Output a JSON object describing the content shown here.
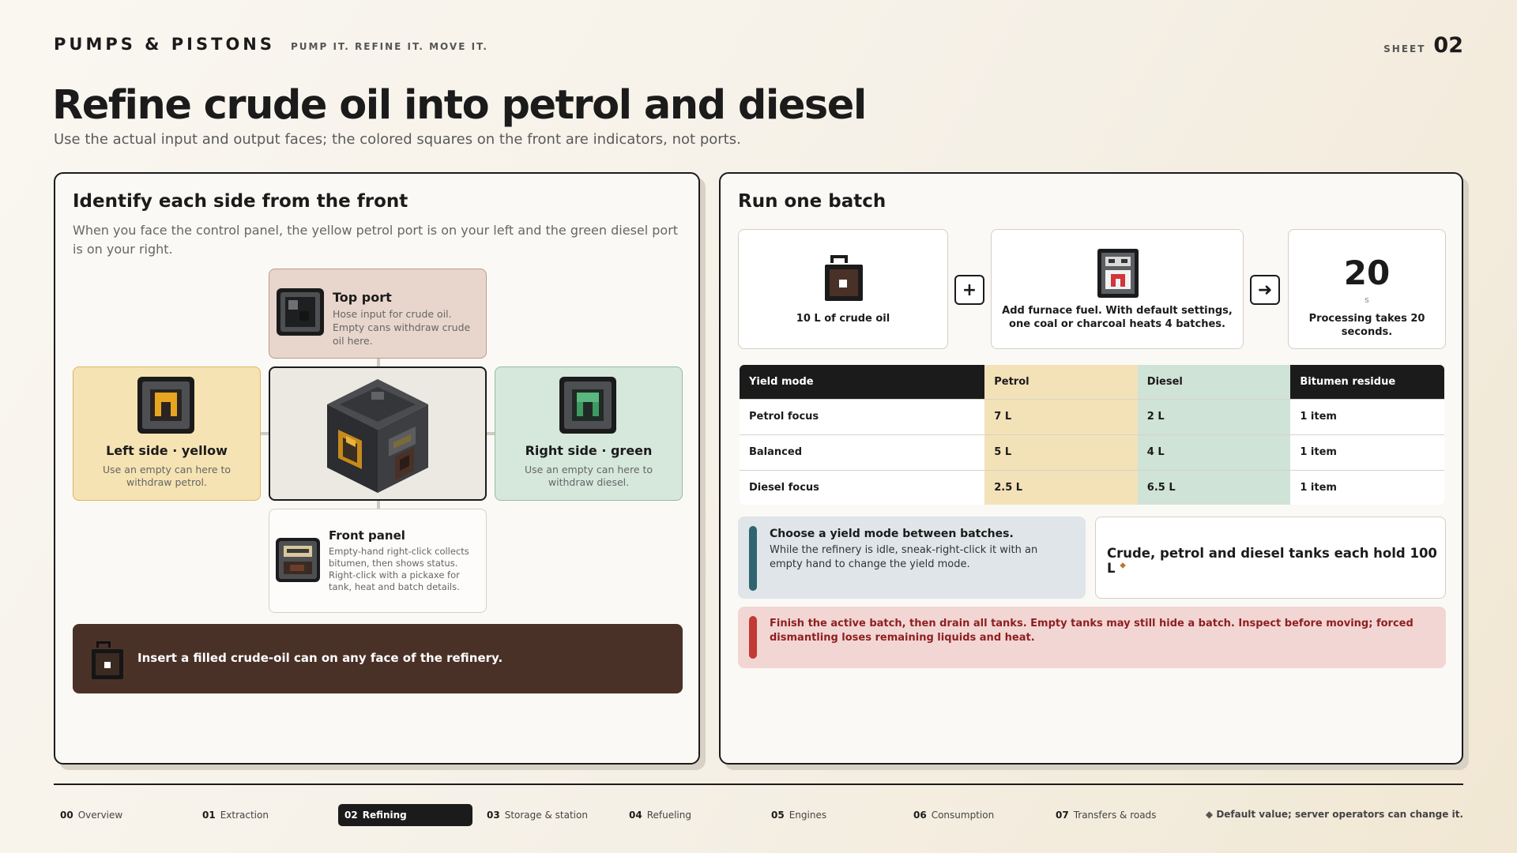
{
  "header": {
    "brand": "PUMPS & PISTONS",
    "tagline": "PUMP IT. REFINE IT. MOVE IT.",
    "sheet_label": "SHEET",
    "sheet_number": "02",
    "title": "Refine crude oil into petrol and diesel",
    "subtitle": "Use the actual input and output faces; the colored squares on the front are indicators, not ports."
  },
  "left_panel": {
    "title": "Identify each side from the front",
    "description": "When you face the control panel, the yellow petrol port is on your left and the green diesel port is on your right.",
    "top_port": {
      "title": "Top port",
      "text": "Hose input for crude oil. Empty cans withdraw crude oil here."
    },
    "left_side": {
      "title": "Left side · yellow",
      "text": "Use an empty can here to withdraw petrol."
    },
    "right_side": {
      "title": "Right side · green",
      "text": "Use an empty can here to withdraw diesel."
    },
    "front_panel": {
      "title": "Front panel",
      "text": "Empty-hand right-click collects bitumen, then shows status. Right-click with a pickaxe for tank, heat and batch details."
    },
    "insert_note": "Insert a filled crude-oil can on any face of the refinery."
  },
  "right_panel": {
    "title": "Run one batch",
    "step_input": "10 L of crude oil",
    "step_fuel": "Add furnace fuel. With default settings, one coal or charcoal heats 4 batches.",
    "plus": "+",
    "arrow": "➜",
    "processing_value": "20",
    "processing_unit": "s",
    "processing_text": "Processing takes 20 seconds.",
    "table": {
      "headers": [
        "Yield mode",
        "Petrol",
        "Diesel",
        "Bitumen residue"
      ],
      "rows": [
        [
          "Petrol focus",
          "7 L",
          "2 L",
          "1 item"
        ],
        [
          "Balanced",
          "5 L",
          "4 L",
          "1 item"
        ],
        [
          "Diesel focus",
          "2.5 L",
          "6.5 L",
          "1 item"
        ]
      ]
    },
    "yield_note": {
      "title": "Choose a yield mode between batches.",
      "body": "While the refinery is idle, sneak-right-click it with an empty hand to change the yield mode."
    },
    "tank_note": "Crude, petrol and diesel tanks each hold 100 L",
    "tank_marker": "◆",
    "warning": "Finish the active batch, then drain all tanks. Empty tanks may still hide a batch. Inspect before moving; forced dismantling loses remaining liquids and heat."
  },
  "footer": {
    "nav": [
      {
        "num": "00",
        "label": "Overview"
      },
      {
        "num": "01",
        "label": "Extraction"
      },
      {
        "num": "02",
        "label": "Refining",
        "active": true
      },
      {
        "num": "03",
        "label": "Storage & station"
      },
      {
        "num": "04",
        "label": "Refueling"
      },
      {
        "num": "05",
        "label": "Engines"
      },
      {
        "num": "06",
        "label": "Consumption"
      },
      {
        "num": "07",
        "label": "Transfers & roads"
      }
    ],
    "footnote_marker": "◆",
    "footnote": "Default value; server operators can change it."
  },
  "colors": {
    "petrol": "#f3e2b8",
    "diesel": "#cfe3d6",
    "top_port": "#e8d6cc",
    "insert_bar": "#4a3127",
    "warning": "#f2d6d4",
    "warning_accent": "#c23a34",
    "note_accent": "#2f6470"
  }
}
